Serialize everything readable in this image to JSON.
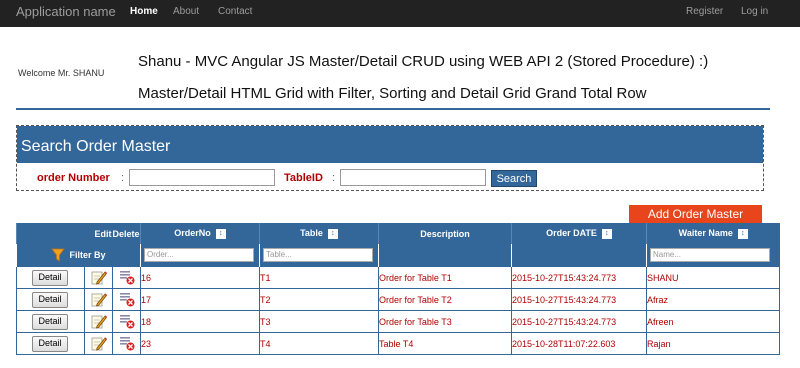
{
  "navbar": {
    "brand": "Application name",
    "links": [
      "Home",
      "About",
      "Contact"
    ],
    "right_links": [
      "Register",
      "Log in"
    ]
  },
  "welcome": "Welcome Mr. SHANU",
  "title_line1": "Shanu - MVC Angular JS Master/Detail CRUD using WEB API 2 (Stored Procedure) :)",
  "title_line2": "Master/Detail HTML Grid with Filter, Sorting and Detail Grid Grand Total Row",
  "search": {
    "title": "Search Order Master",
    "order_label": "order Number",
    "table_label": "TableID",
    "colon": ":",
    "button": "Search"
  },
  "add_button": "Add Order Master",
  "grid": {
    "headers": {
      "edit": "Edit",
      "delete": "Delete",
      "order_no": "OrderNo",
      "table": "Table",
      "description": "Description",
      "order_date": "Order DATE",
      "waiter": "Waiter Name"
    },
    "filter_label": "Filter By",
    "placeholders": {
      "order": "Order...",
      "table": "Table...",
      "name": "Name..."
    },
    "detail_label": "Detail",
    "rows": [
      {
        "order_no": "16",
        "table": "T1",
        "description": "Order for Table T1",
        "date": "2015-10-27T15:43:24.773",
        "waiter": "SHANU"
      },
      {
        "order_no": "17",
        "table": "T2",
        "description": "Order for Table T2",
        "date": "2015-10-27T15:43:24.773",
        "waiter": "Afraz"
      },
      {
        "order_no": "18",
        "table": "T3",
        "description": "Order for Table T3",
        "date": "2015-10-27T15:43:24.773",
        "waiter": "Afreen"
      },
      {
        "order_no": "23",
        "table": "T4",
        "description": "Table T4",
        "date": "2015-10-28T11:07:22.603",
        "waiter": "Rajan"
      }
    ]
  },
  "colors": {
    "navbar": "#222222",
    "primary": "#336699",
    "accent": "#e8451d",
    "data_text": "#b00000"
  },
  "icons": [
    "filter-funnel-icon",
    "sort-icon",
    "edit-pencil-icon",
    "delete-icon"
  ]
}
